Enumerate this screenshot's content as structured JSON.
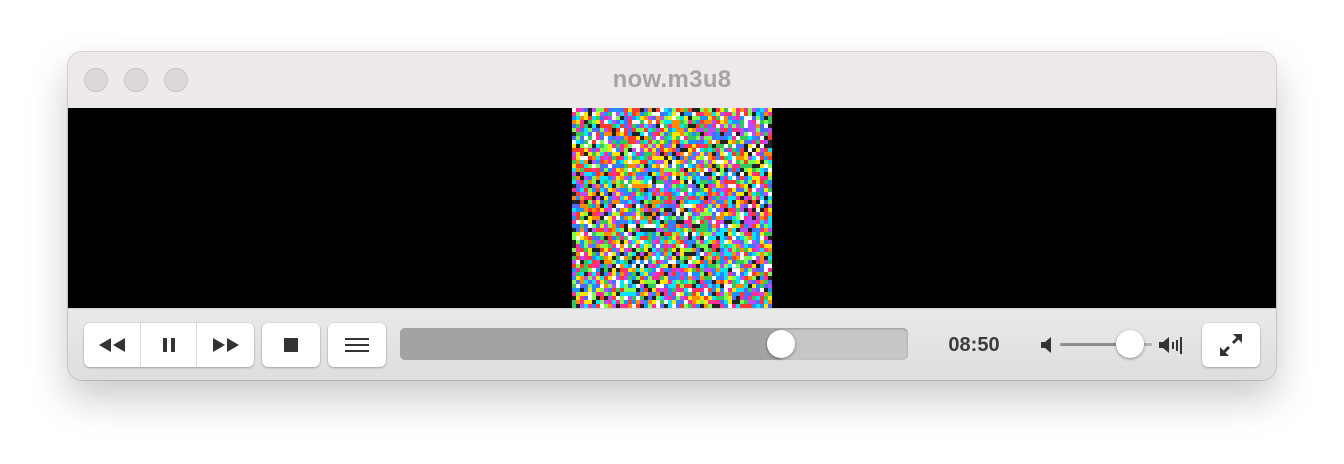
{
  "window": {
    "title": "now.m3u8",
    "traffic_lights": [
      "close-button",
      "minimize-button",
      "zoom-button"
    ]
  },
  "controls": {
    "icons": {
      "rewind": "rewind-icon",
      "pause": "pause-icon",
      "fast_forward": "fast-forward-icon",
      "stop": "stop-icon",
      "playlist": "playlist-icon",
      "volume_low": "volume-low-icon",
      "volume_high": "volume-high-icon",
      "fullscreen": "fullscreen-icon"
    },
    "elapsed_time": "08:50",
    "seek_fraction": 0.75,
    "volume_fraction": 0.76
  },
  "colors": {
    "titlebar": "#ede8ec",
    "video_background": "#000000"
  }
}
